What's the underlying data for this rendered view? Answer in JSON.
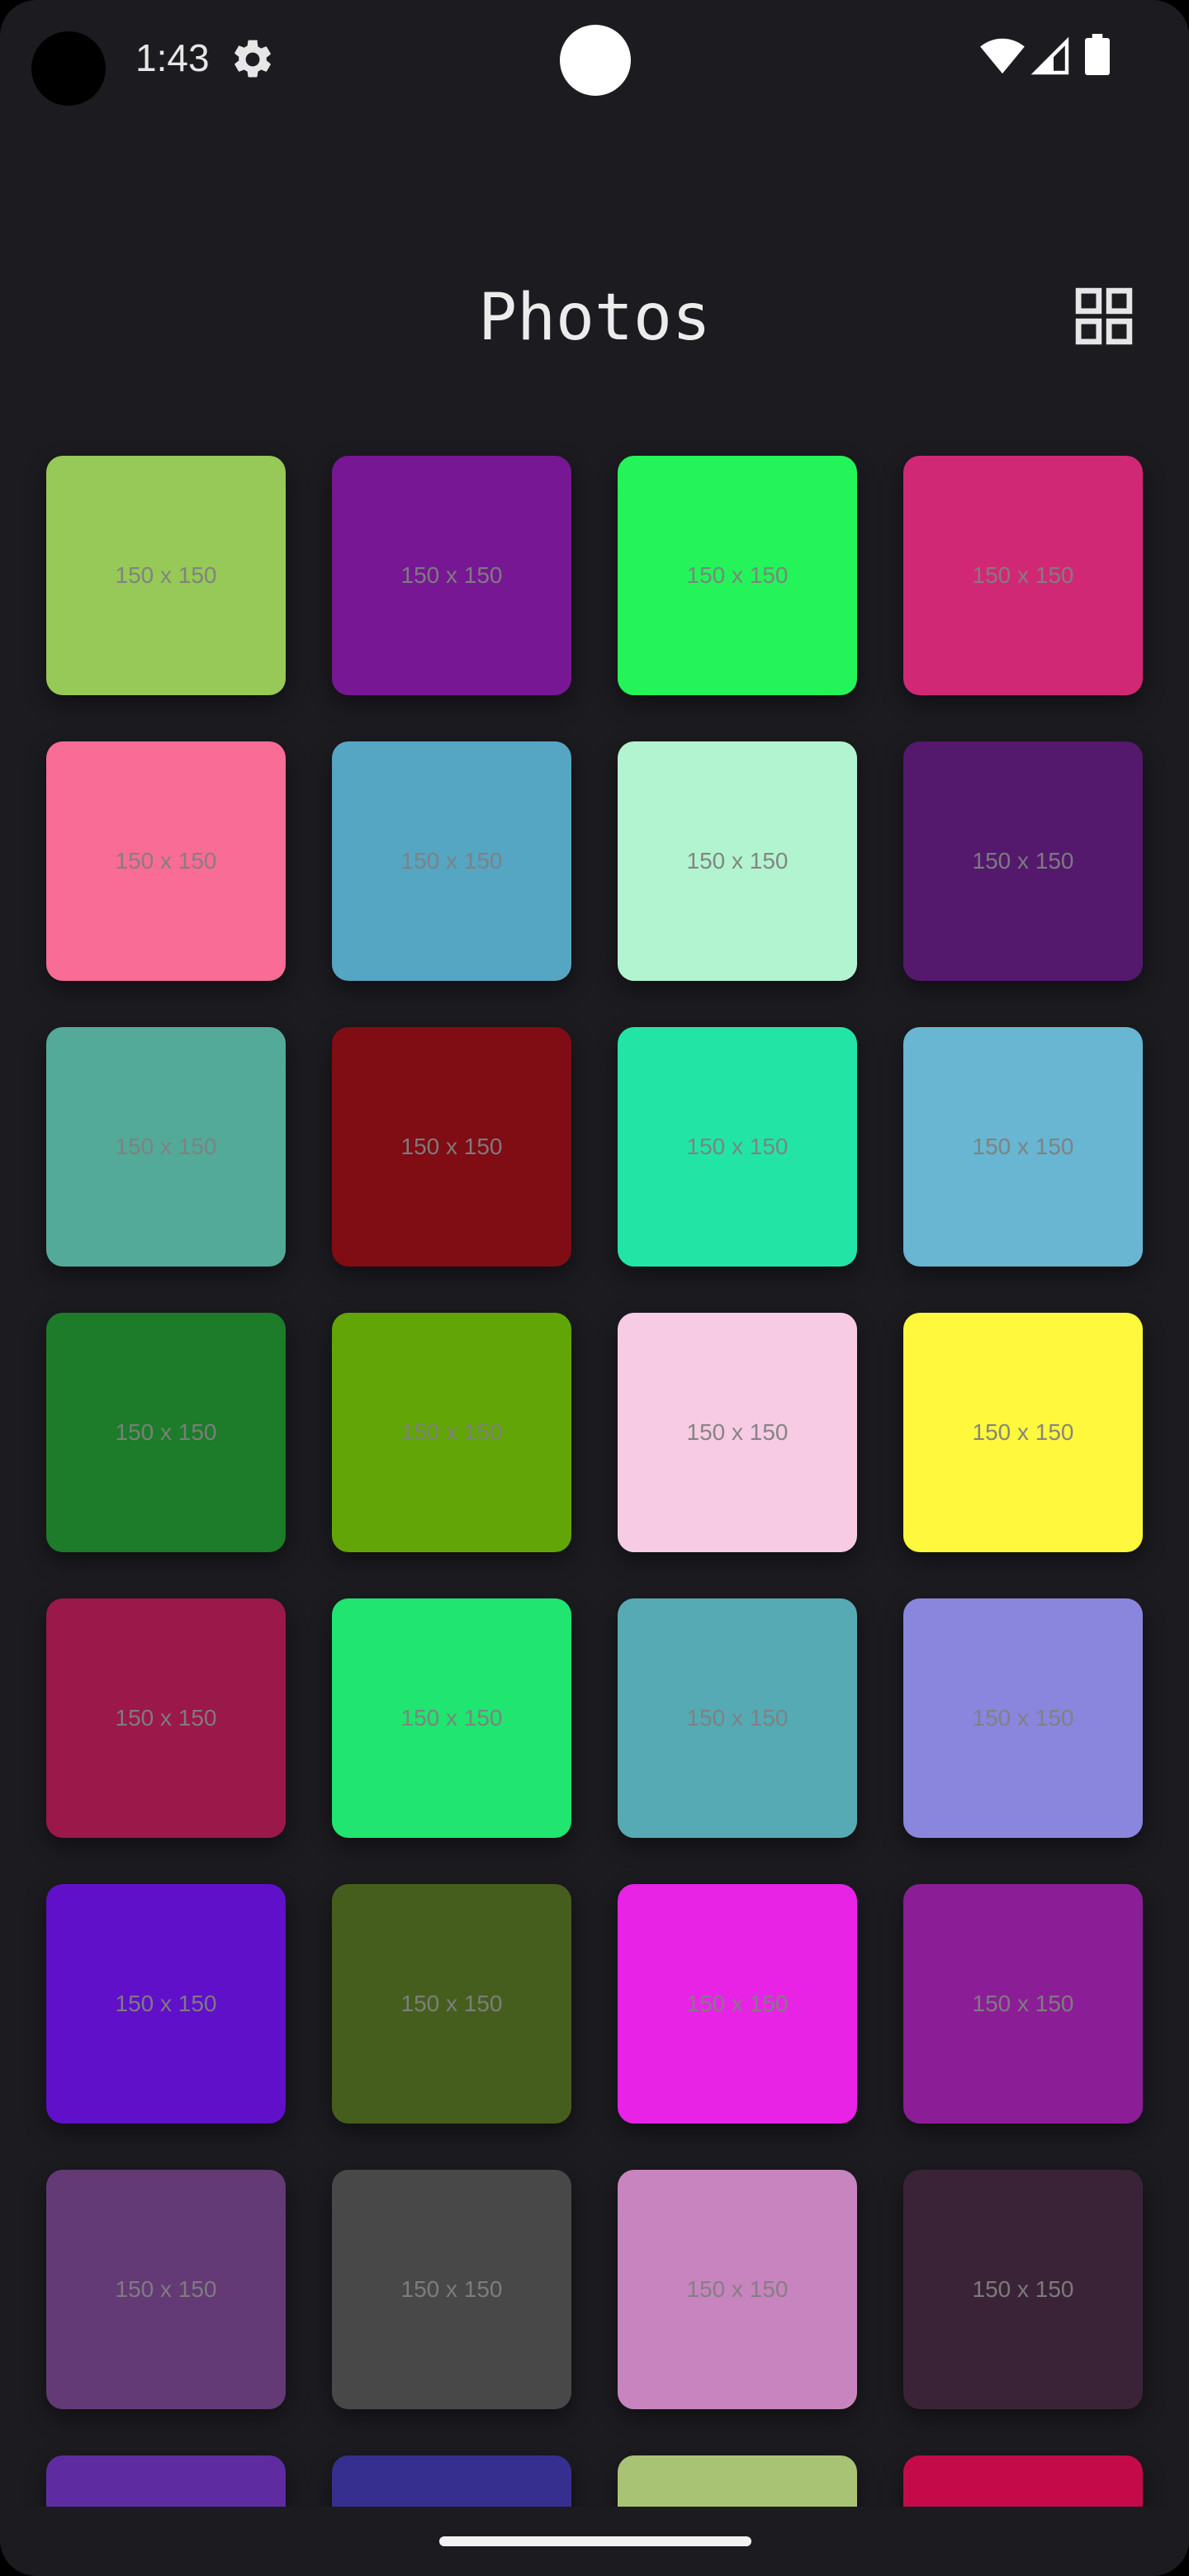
{
  "status_bar": {
    "time": "1:43",
    "icons": [
      "settings-icon",
      "wifi-icon",
      "signal-icon",
      "battery-icon"
    ]
  },
  "header": {
    "title": "Photos",
    "layout_toggle_icon": "grid-view-icon"
  },
  "photos": {
    "label": "150 x 150",
    "tile_colors": [
      "#96c957",
      "#771793",
      "#24f45a",
      "#d12875",
      "#f86c96",
      "#55a6c2",
      "#b2f4cf",
      "#54196c",
      "#54aa98",
      "#800c14",
      "#22e5a5",
      "#68b6d1",
      "#1c7c2a",
      "#62a506",
      "#f6cbe3",
      "#fff83d",
      "#9b184a",
      "#20e571",
      "#56aab3",
      "#8a86dd",
      "#5f10c8",
      "#465e1d",
      "#e823e6",
      "#8b1e96",
      "#633a75",
      "#484848",
      "#c884be",
      "#3b2337",
      "#5e2ca0",
      "#372f90",
      "#a8c374",
      "#c50a4a"
    ]
  },
  "colors": {
    "background": "#1c1b20",
    "text": "#ececec",
    "tile_label": "#808080"
  }
}
